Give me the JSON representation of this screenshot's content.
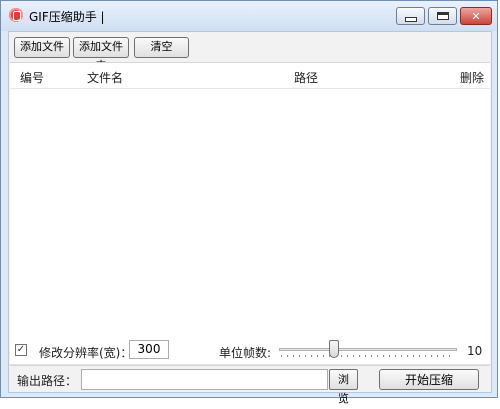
{
  "window": {
    "title": "GIF压缩助手 |",
    "close_symbol": "✕"
  },
  "toolbar": {
    "add_file_label": "添加文件",
    "add_folder_label": "添加文件夹",
    "clear_label": "清空"
  },
  "list": {
    "columns": [
      "编号",
      "文件名",
      "路径",
      "删除"
    ],
    "rows": []
  },
  "options": {
    "resize_checked": true,
    "check_mark": "✓",
    "resize_label": "修改分辨率(宽)：",
    "width_value": "300",
    "fps_label": "单位帧数:",
    "fps_value": "10",
    "fps_min": 1,
    "fps_max": 30
  },
  "output": {
    "path_label": "输出路径：",
    "path_value": "",
    "browse_label": "浏览",
    "start_label": "开始压缩"
  }
}
